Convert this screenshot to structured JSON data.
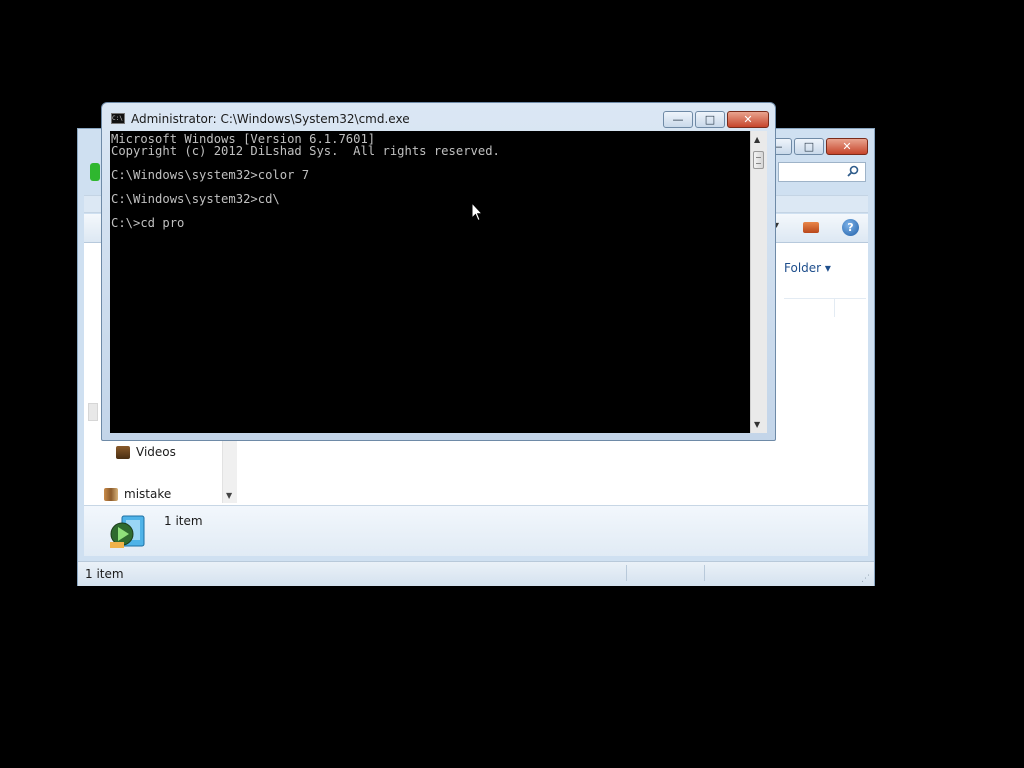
{
  "explorer": {
    "window_buttons": {
      "minimize": "—",
      "maximize": "□",
      "close": "✕"
    },
    "search_icon": "search-icon",
    "folder_button": "Folder ▾",
    "nav": {
      "items": [
        {
          "label": "Videos",
          "icon": "video-library-icon"
        },
        {
          "label": "mistake",
          "icon": "homegroup-user-icon"
        }
      ]
    },
    "details": {
      "count": "1 item",
      "icon": "media-player-icon"
    },
    "status": {
      "text": "1 item"
    }
  },
  "cmd": {
    "title": "Administrator: C:\\Windows\\System32\\cmd.exe",
    "window_buttons": {
      "minimize": "—",
      "maximize": "□",
      "close": "✕"
    },
    "console_lines": [
      "Microsoft Windows [Version 6.1.7601]",
      "Copyright (c) 2012 DiLshad Sys.  All rights reserved.",
      "",
      "C:\\Windows\\system32>color 7",
      "",
      "C:\\Windows\\system32>cd\\",
      "",
      "C:\\>cd pro"
    ],
    "scroll": {
      "up": "▲",
      "down": "▼"
    }
  },
  "colors": {
    "console_bg": "#000000",
    "console_fg": "#c0c0c0",
    "desktop": "#000000",
    "close_button": "#c6452b"
  }
}
